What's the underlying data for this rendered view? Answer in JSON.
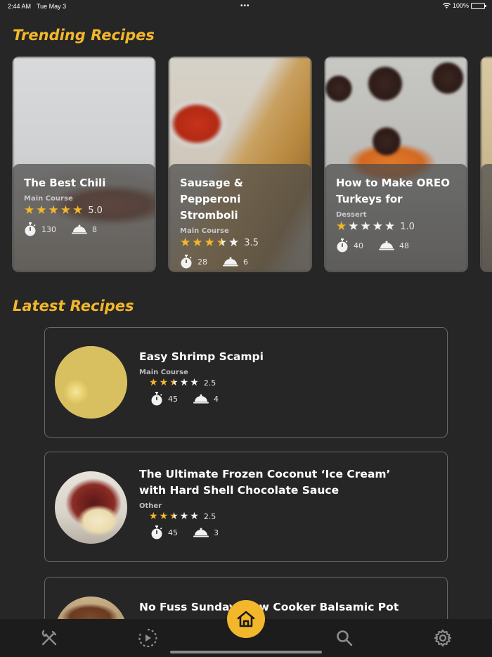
{
  "status_bar": {
    "time": "2:44 AM",
    "date": "Tue May 3",
    "battery": "100%"
  },
  "trending": {
    "title": "Trending Recipes",
    "cards": [
      {
        "name": "The Best Chili",
        "category": "Main Course",
        "rating": "5.0",
        "rating_value": 5.0,
        "time": "130",
        "servings": "8"
      },
      {
        "name": "Sausage & Pepperoni Stromboli",
        "category": "Main Course",
        "rating": "3.5",
        "rating_value": 3.5,
        "time": "28",
        "servings": "6"
      },
      {
        "name": "How to Make OREO Turkeys for",
        "category": "Dessert",
        "rating": "1.0",
        "rating_value": 1.0,
        "time": "40",
        "servings": "48"
      }
    ]
  },
  "latest": {
    "title": "Latest Recipes",
    "cards": [
      {
        "name": "Easy Shrimp Scampi",
        "category": "Main Course",
        "rating": "2.5",
        "rating_value": 2.5,
        "time": "45",
        "servings": "4"
      },
      {
        "name": "The Ultimate Frozen Coconut ‘Ice Cream’ with Hard Shell Chocolate Sauce",
        "category": "Other",
        "rating": "2.5",
        "rating_value": 2.5,
        "time": "45",
        "servings": "3"
      },
      {
        "name": "No Fuss Sunday Slow Cooker Balsamic Pot Roast"
      }
    ]
  },
  "tab_bar": {
    "items": [
      {
        "icon": "fork-knife-icon"
      },
      {
        "icon": "play-circle-icon"
      },
      {
        "icon": "home-icon"
      },
      {
        "icon": "search-icon"
      },
      {
        "icon": "gear-icon"
      }
    ]
  },
  "colors": {
    "accent": "#f3b72b",
    "background": "#262626"
  }
}
